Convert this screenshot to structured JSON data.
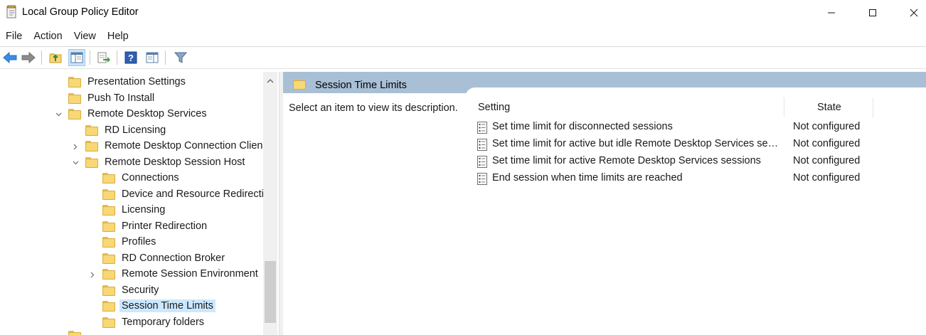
{
  "window": {
    "title": "Local Group Policy Editor",
    "icon": "policy-editor-icon"
  },
  "menu": [
    "File",
    "Action",
    "View",
    "Help"
  ],
  "toolbar": {
    "icons": [
      "back-arrow-icon",
      "forward-arrow-icon",
      "up-folder-icon",
      "show-hide-tree-icon",
      "export-list-icon",
      "help-icon",
      "show-hide-action-pane-icon",
      "filter-icon"
    ]
  },
  "tree": {
    "items": [
      {
        "label": "Presentation Settings",
        "level": 2,
        "expander": ""
      },
      {
        "label": "Push To Install",
        "level": 2,
        "expander": ""
      },
      {
        "label": "Remote Desktop Services",
        "level": 2,
        "expander": "expanded"
      },
      {
        "label": "RD Licensing",
        "level": 3,
        "expander": ""
      },
      {
        "label": "Remote Desktop Connection Clien",
        "level": 3,
        "expander": "collapsed"
      },
      {
        "label": "Remote Desktop Session Host",
        "level": 3,
        "expander": "expanded"
      },
      {
        "label": "Connections",
        "level": 4,
        "expander": ""
      },
      {
        "label": "Device and Resource Redirectic",
        "level": 4,
        "expander": ""
      },
      {
        "label": "Licensing",
        "level": 4,
        "expander": ""
      },
      {
        "label": "Printer Redirection",
        "level": 4,
        "expander": ""
      },
      {
        "label": "Profiles",
        "level": 4,
        "expander": ""
      },
      {
        "label": "RD Connection Broker",
        "level": 4,
        "expander": ""
      },
      {
        "label": "Remote Session Environment",
        "level": 4,
        "expander": "collapsed"
      },
      {
        "label": "Security",
        "level": 4,
        "expander": ""
      },
      {
        "label": "Session Time Limits",
        "level": 4,
        "expander": "",
        "selected": true
      },
      {
        "label": "Temporary folders",
        "level": 4,
        "expander": ""
      }
    ]
  },
  "details": {
    "header_title": "Session Time Limits",
    "description": "Select an item to view its description.",
    "columns": {
      "setting": "Setting",
      "state": "State"
    },
    "rows": [
      {
        "setting": "Set time limit for disconnected sessions",
        "state": "Not configured"
      },
      {
        "setting": "Set time limit for active but idle Remote Desktop Services sessions",
        "state": "Not configured"
      },
      {
        "setting": "Set time limit for active Remote Desktop Services sessions",
        "state": "Not configured"
      },
      {
        "setting": "End session when time limits are reached",
        "state": "Not configured"
      }
    ]
  },
  "colors": {
    "header_band": "#a9bfd6",
    "selection": "#cce8ff",
    "folder": "#f8d775"
  }
}
